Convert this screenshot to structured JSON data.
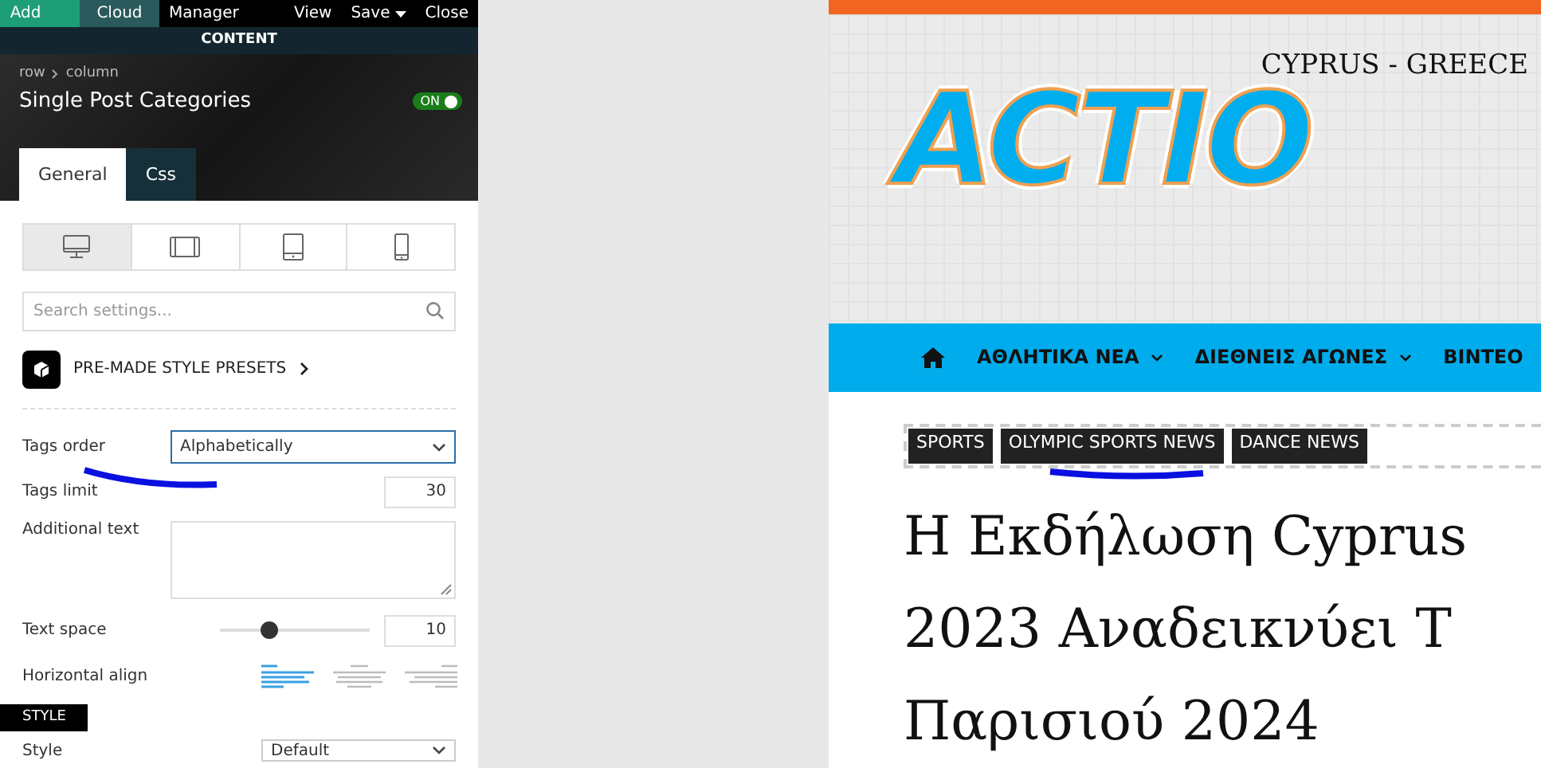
{
  "topbar": {
    "left": [
      {
        "label": "Add",
        "kind": "add"
      },
      {
        "label": "Cloud",
        "kind": "cloud"
      },
      {
        "label": "Manager",
        "kind": "plain"
      }
    ],
    "right": [
      {
        "label": "View",
        "kind": "plain"
      },
      {
        "label": "Save",
        "kind": "menu"
      },
      {
        "label": "Close",
        "kind": "plain"
      }
    ]
  },
  "section_bar": "CONTENT",
  "header": {
    "breadcrumb": [
      "row",
      "column"
    ],
    "title": "Single Post Categories",
    "toggle": {
      "label": "ON",
      "on": true
    }
  },
  "tabs": [
    {
      "label": "General",
      "selected": true
    },
    {
      "label": "Css",
      "selected": false
    }
  ],
  "devices": [
    {
      "kind": "desktop",
      "selected": true
    },
    {
      "kind": "tablet-landscape",
      "selected": false
    },
    {
      "kind": "tablet",
      "selected": false
    },
    {
      "kind": "phone",
      "selected": false
    }
  ],
  "search": {
    "placeholder": "Search settings..."
  },
  "presets": {
    "label": "PRE-MADE STYLE PRESETS"
  },
  "settings": [
    {
      "kind": "select",
      "label": "Tags order",
      "value": "Alphabetically"
    },
    {
      "kind": "number",
      "label": "Tags limit",
      "value": "30"
    },
    {
      "kind": "textarea",
      "label": "Additional text"
    },
    {
      "kind": "slider",
      "label": "Text space",
      "value": "10",
      "level": 0.33
    },
    {
      "kind": "align",
      "label": "Horizontal align",
      "options": [
        {
          "kind": "left",
          "selected": true
        },
        {
          "kind": "center",
          "selected": false
        },
        {
          "kind": "right",
          "selected": false
        }
      ]
    }
  ],
  "style_section": {
    "heading": "STYLE",
    "fields": [
      {
        "kind": "select",
        "label": "Style",
        "value": "Default"
      }
    ]
  },
  "site": {
    "tagline": "CYPRUS - GREECE",
    "logo": "ACTIO",
    "nav": [
      {
        "label": "ΑΘΛΗΤΙΚΑ ΝΕΑ",
        "dropdown": true
      },
      {
        "label": "ΔΙΕΘΝΕΙΣ ΑΓΩΝΕΣ",
        "dropdown": true
      },
      {
        "label": "ΒΙΝΤΕΟ",
        "dropdown": false
      }
    ],
    "tags": [
      "SPORTS",
      "OLYMPIC SPORTS NEWS",
      "DANCE NEWS"
    ],
    "headline": [
      "Η Εκδήλωση Cyprus",
      "2023 Αναδεικνύει Τ",
      "Παρισιού 2024"
    ]
  }
}
